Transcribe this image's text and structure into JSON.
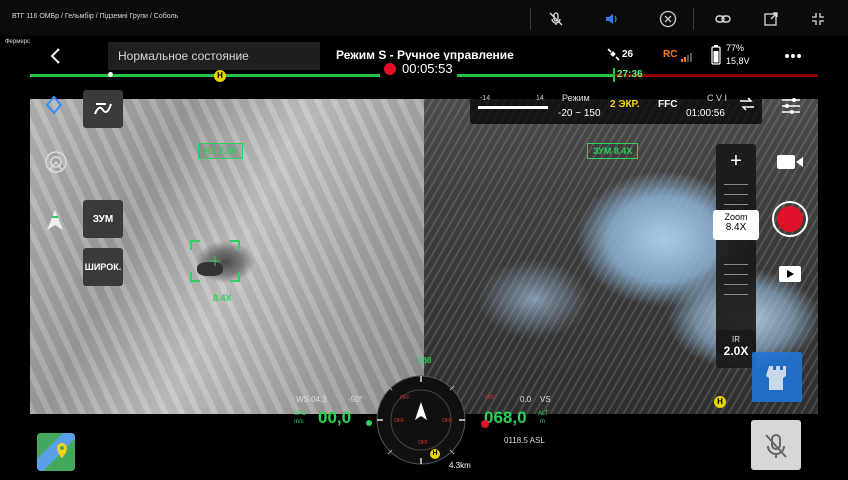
{
  "meeting": {
    "title": "ВТГ 116 ОМБр / Гельмбір / Підземні Групи / Соболь",
    "side_label": "Фермерська"
  },
  "topbar": {
    "status": "Нормальное состояние",
    "mode": "Режим S - Ручное управление",
    "satellites": "26",
    "rc_label": "RC",
    "battery_percent": "77%",
    "battery_voltage": "15,8V"
  },
  "recording": {
    "timer": "00:05:53"
  },
  "flight": {
    "remaining_time": "27:36",
    "home_marker": "H"
  },
  "camera_bar": {
    "ev_left": "-14",
    "ev_right": "14",
    "mode_label": "Режим",
    "mode_value": "-20 ~ 150",
    "screens": "2 ЭКР.",
    "ffc": "FFC",
    "cvi_label": "C V I",
    "cvi_time": "01:00:56"
  },
  "left_feed": {
    "zoom_label": "ИК 2.0X",
    "target_label": "8.4X",
    "tool_zoom": "ЗУМ",
    "tool_wide": "ШИРОК."
  },
  "right_feed": {
    "zoom_label": "ЗУМ 8.4X"
  },
  "zoom_panel": {
    "plus": "+",
    "minus": "−",
    "zoom_label": "Zoom",
    "zoom_value": "8.4X",
    "ir_label": "IR",
    "ir_value": "2.0X"
  },
  "telemetry": {
    "heading": "180",
    "ws_label": "WS 04.3",
    "pitch": "-50°",
    "spd_label": "SPD",
    "spd_unit": "m/s",
    "speed": "00,0",
    "vs_value": "0.0",
    "vs_label": "VS",
    "alt_label": "ALT",
    "alt_unit": "m",
    "altitude": "068,0",
    "asl": "0118.5 ASL",
    "distance": "4.3km",
    "home_marker": "H",
    "off_labels": [
      "OFF",
      "OFF",
      "OFF",
      "OFF",
      "OFF"
    ]
  },
  "colors": {
    "accent_green": "#2bd35a",
    "record_red": "#e0122a",
    "warning_orange": "#ff7a1a",
    "label_yellow": "#f3d31a"
  }
}
